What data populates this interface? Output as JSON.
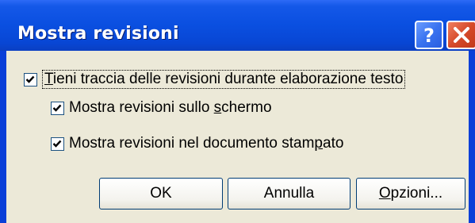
{
  "window": {
    "title": "Mostra revisioni"
  },
  "titlebar": {
    "help_icon": "question-mark-icon",
    "close_icon": "close-x-icon"
  },
  "options": [
    {
      "label_pre": "",
      "label_ul": "T",
      "label_post": "ieni traccia delle revisioni durante elaborazione testo",
      "checked": true,
      "focused": true
    },
    {
      "label_pre": "Mostra revisioni sullo ",
      "label_ul": "s",
      "label_post": "chermo",
      "checked": true,
      "focused": false
    },
    {
      "label_pre": "Mostra revisioni nel documento stam",
      "label_ul": "p",
      "label_post": "ato",
      "checked": true,
      "focused": false
    }
  ],
  "buttons": {
    "ok_label": "OK",
    "cancel_label": "Annulla",
    "options_label_ul": "O",
    "options_label_rest": "pzioni..."
  },
  "colors": {
    "titlebar_blue": "#0a4fe0",
    "dialog_face": "#ece9d8",
    "close_red": "#d64a2a"
  }
}
